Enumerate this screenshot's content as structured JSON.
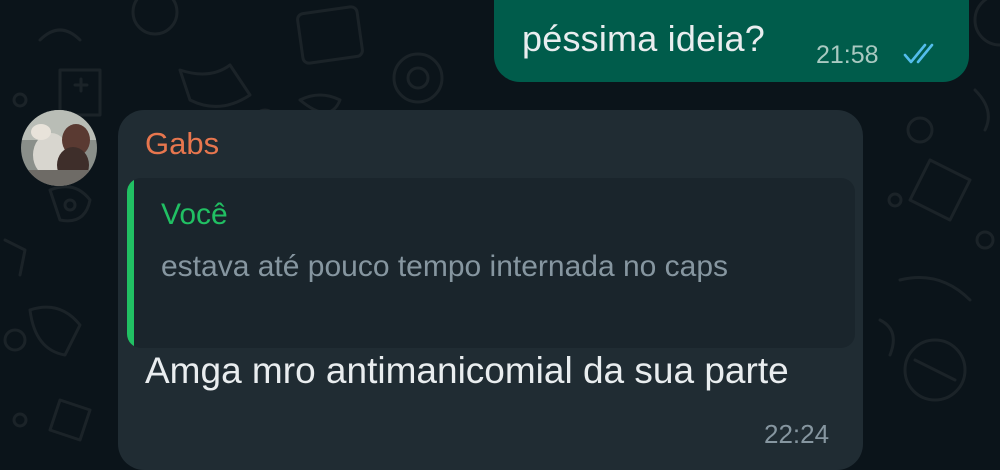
{
  "colors": {
    "background": "#0b141a",
    "outgoing_bubble": "#005c4b",
    "incoming_bubble": "#202c33",
    "quote_background": "#1a252c",
    "sender_name": "#e7764e",
    "quote_accent": "#21c063",
    "read_ticks": "#53bdeb"
  },
  "outgoing_message": {
    "text": "péssima ideia?",
    "time": "21:58",
    "status_icon": "double-check-read-icon"
  },
  "incoming_message": {
    "sender": "Gabs",
    "avatar_icon": "contact-avatar",
    "quoted": {
      "author": "Você",
      "text": "estava até pouco tempo internada no caps"
    },
    "text": "Amga mro antimanicomial da sua parte",
    "time": "22:24"
  }
}
